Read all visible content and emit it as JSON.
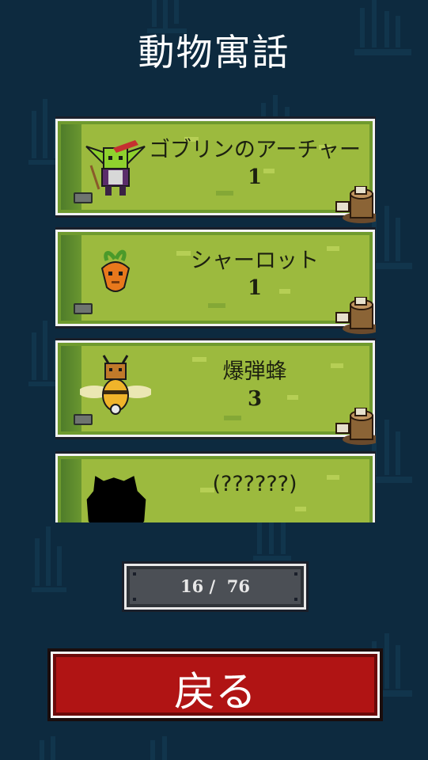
{
  "screen": {
    "title": "動物寓話",
    "background_color": "#0d2a3f"
  },
  "bestiary": {
    "entries": [
      {
        "name": "ゴブリンのアーチャー",
        "count": "1",
        "icon": "goblin-archer-icon"
      },
      {
        "name": "シャーロット",
        "count": "1",
        "icon": "carrot-monster-icon"
      },
      {
        "name": "爆弾蜂",
        "count": "3",
        "icon": "bomb-bee-icon"
      },
      {
        "name": "(??????)",
        "count": "",
        "icon": "unknown-silhouette-icon"
      }
    ]
  },
  "progress": {
    "text": "16 /  76",
    "discovered": 16,
    "total": 76
  },
  "buttons": {
    "back_label": "戻る",
    "back_color": "#b01414"
  }
}
